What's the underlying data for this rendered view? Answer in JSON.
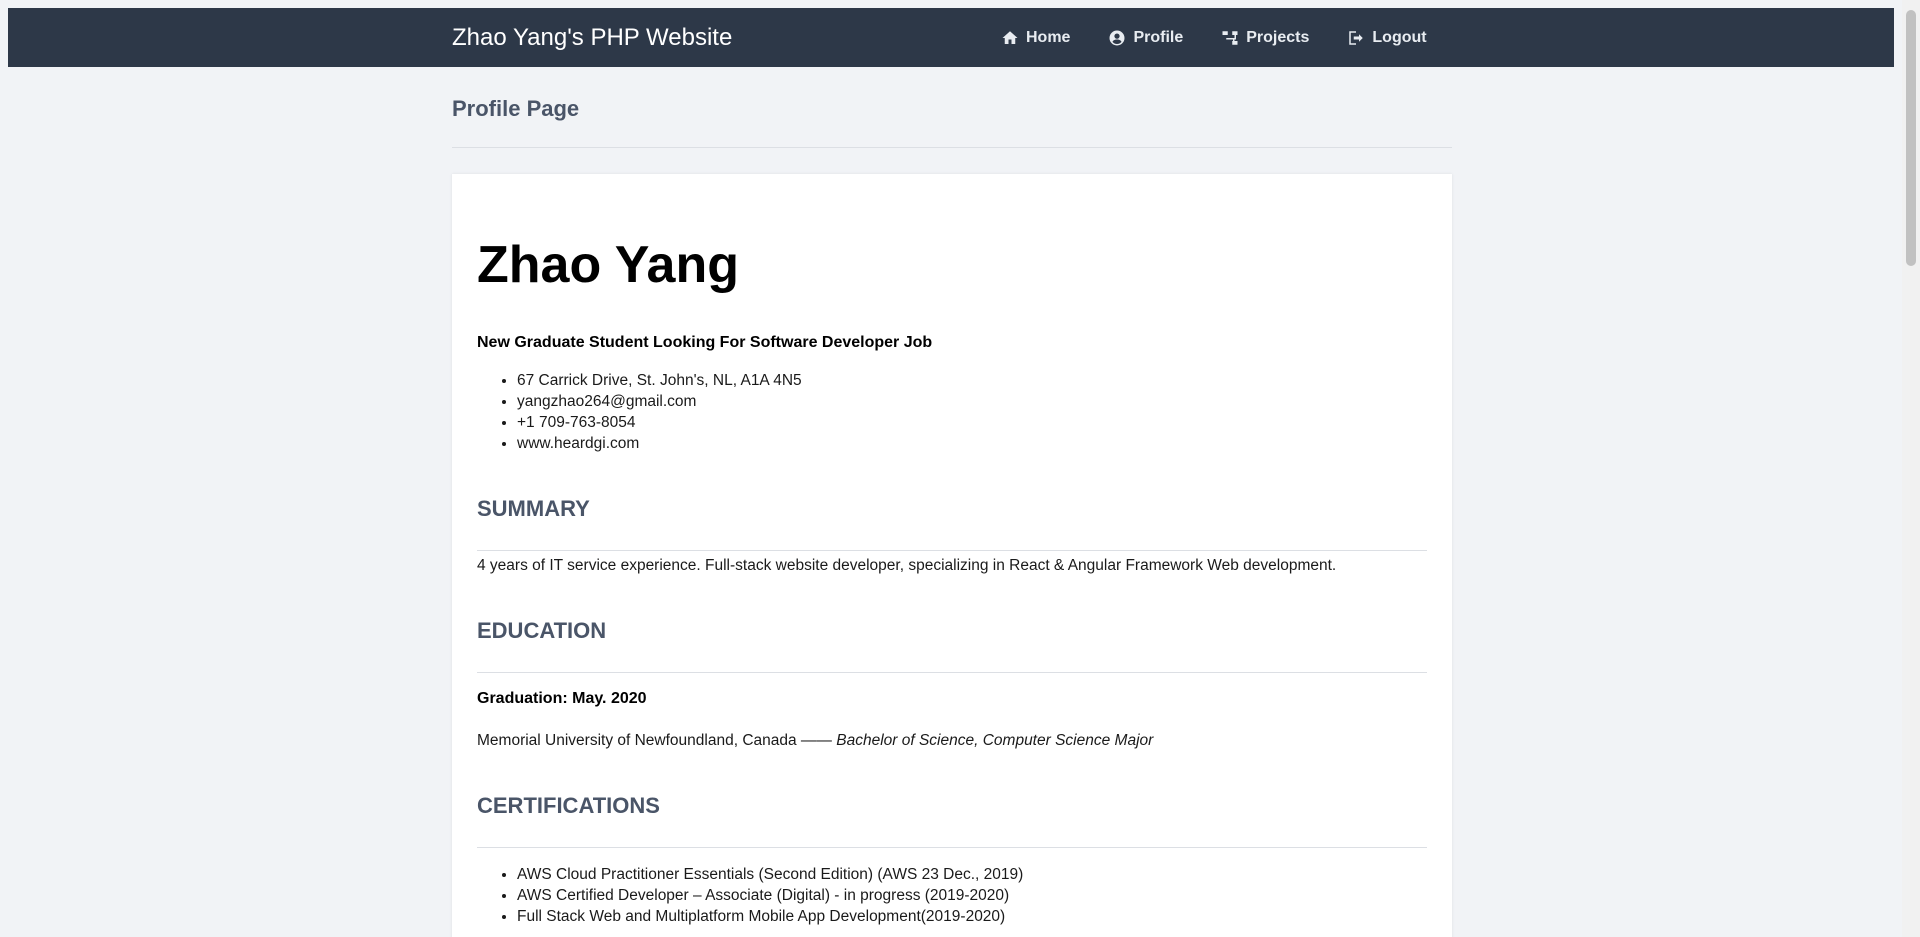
{
  "navbar": {
    "brand": "Zhao Yang's PHP Website",
    "links": [
      {
        "label": "Home",
        "icon": "home-icon"
      },
      {
        "label": "Profile",
        "icon": "user-circle-icon"
      },
      {
        "label": "Projects",
        "icon": "sitemap-icon"
      },
      {
        "label": "Logout",
        "icon": "sign-out-icon"
      }
    ]
  },
  "page": {
    "title": "Profile Page"
  },
  "resume": {
    "name": "Zhao Yang",
    "tagline": "New Graduate Student Looking For Software Developer Job",
    "contact": [
      "67 Carrick Drive, St. John's, NL, A1A 4N5",
      "yangzhao264@gmail.com",
      "+1 709-763-8054",
      "www.heardgi.com"
    ],
    "summary": {
      "heading": "SUMMARY",
      "text": " 4 years of IT service experience. Full-stack website developer, specializing in React & Angular Framework Web development."
    },
    "education": {
      "heading": "EDUCATION",
      "graduation": "Graduation: May. 2020",
      "school": " Memorial University of Newfoundland, Canada —— ",
      "degree": "Bachelor of Science, Computer Science Major"
    },
    "certifications": {
      "heading": "CERTIFICATIONS",
      "items": [
        "AWS Cloud Practitioner Essentials (Second Edition) (AWS 23 Dec., 2019)",
        "AWS Certified Developer – Associate (Digital) - in progress (2019-2020)",
        "Full Stack Web and Multiplatform Mobile App Development(2019-2020)"
      ]
    }
  },
  "colors": {
    "navbar_bg": "#2d3848",
    "page_bg": "#f1f3f6",
    "heading": "#4a5568"
  }
}
